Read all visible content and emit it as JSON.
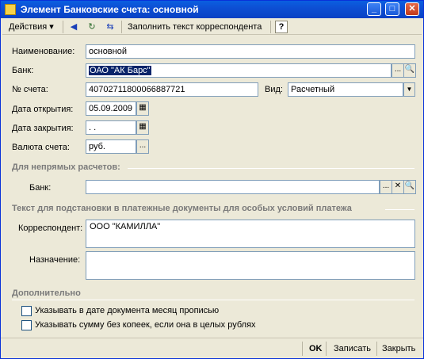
{
  "window": {
    "title": "Элемент Банковские счета: основной"
  },
  "toolbar": {
    "actions_label": "Действия",
    "fill_label": "Заполнить текст корреспондента",
    "help_label": "?"
  },
  "form": {
    "name": {
      "label": "Наименование:",
      "value": "основной"
    },
    "bank": {
      "label": "Банк:",
      "value": "ОАО \"АК Барс\""
    },
    "account": {
      "label": "№ счета:",
      "value": "40702711800066887721"
    },
    "kind": {
      "label": "Вид:",
      "value": "Расчетный"
    },
    "open_date": {
      "label": "Дата открытия:",
      "value": "05.09.2009"
    },
    "close_date": {
      "label": "Дата закрытия:",
      "value": " .  .   "
    },
    "currency": {
      "label": "Валюта счета:",
      "value": "руб."
    }
  },
  "indirect": {
    "title": "Для непрямых расчетов:",
    "bank_label": "Банк:",
    "bank_value": ""
  },
  "text_section": {
    "title": "Текст для подстановки в платежные документы для особых условий платежа",
    "correspondent_label": "Корреспондент:",
    "correspondent_value": "ООО \"КАМИЛЛА\"",
    "purpose_label": "Назначение:",
    "purpose_value": ""
  },
  "extra": {
    "title": "Дополнительно",
    "check1": "Указывать в дате документа месяц прописью",
    "check2": "Указывать сумму без копеек, если она в целых рублях"
  },
  "footer": {
    "ok": "OK",
    "save": "Записать",
    "close": "Закрыть"
  }
}
